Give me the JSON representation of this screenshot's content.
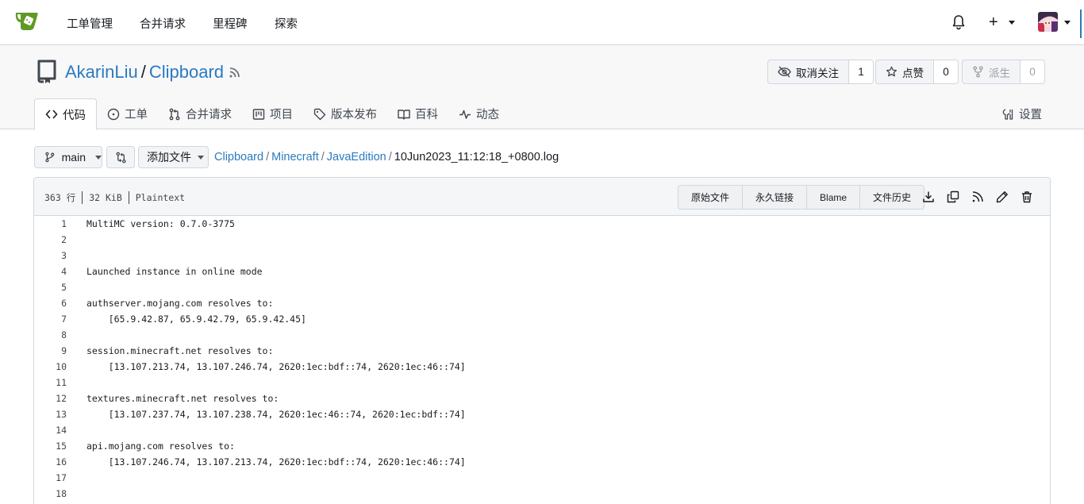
{
  "navbar": {
    "items": [
      {
        "label": "工单管理"
      },
      {
        "label": "合并请求"
      },
      {
        "label": "里程碑"
      },
      {
        "label": "探索"
      }
    ],
    "icons": {
      "bell": "bell-icon",
      "plus": "plus-icon",
      "avatar": "avatar"
    }
  },
  "repo": {
    "owner": "AkarinLiu",
    "separator": "/",
    "name": "Clipboard",
    "watch": {
      "label": "取消关注",
      "count": "1"
    },
    "star": {
      "label": "点赞",
      "count": "0"
    },
    "fork": {
      "label": "派生",
      "count": "0"
    }
  },
  "tabs": [
    {
      "label": "代码",
      "icon": "code-icon"
    },
    {
      "label": "工单",
      "icon": "issue-icon"
    },
    {
      "label": "合并请求",
      "icon": "pull-request-icon"
    },
    {
      "label": "项目",
      "icon": "project-icon"
    },
    {
      "label": "版本发布",
      "icon": "tag-icon"
    },
    {
      "label": "百科",
      "icon": "book-icon"
    },
    {
      "label": "动态",
      "icon": "pulse-icon"
    }
  ],
  "settings_tab": {
    "label": "设置"
  },
  "toolbar": {
    "branch": "main",
    "add_file": "添加文件",
    "breadcrumb": [
      {
        "label": "Clipboard"
      },
      {
        "label": "Minecraft"
      },
      {
        "label": "JavaEdition"
      }
    ],
    "file_name": "10Jun2023_11:12:18_+0800.log",
    "sep": "/"
  },
  "file": {
    "lines_info": "363 行",
    "size": "32 KiB",
    "type": "Plaintext",
    "actions": [
      {
        "label": "原始文件"
      },
      {
        "label": "永久链接"
      },
      {
        "label": "Blame"
      },
      {
        "label": "文件历史"
      }
    ]
  },
  "code_lines": [
    {
      "n": "1",
      "text": "MultiMC version: 0.7.0-3775"
    },
    {
      "n": "2",
      "text": ""
    },
    {
      "n": "3",
      "text": ""
    },
    {
      "n": "4",
      "text": "Launched instance in online mode"
    },
    {
      "n": "5",
      "text": ""
    },
    {
      "n": "6",
      "text": "authserver.mojang.com resolves to:"
    },
    {
      "n": "7",
      "text": "    [65.9.42.87, 65.9.42.79, 65.9.42.45]"
    },
    {
      "n": "8",
      "text": ""
    },
    {
      "n": "9",
      "text": "session.minecraft.net resolves to:"
    },
    {
      "n": "10",
      "text": "    [13.107.213.74, 13.107.246.74, 2620:1ec:bdf::74, 2620:1ec:46::74]"
    },
    {
      "n": "11",
      "text": ""
    },
    {
      "n": "12",
      "text": "textures.minecraft.net resolves to:"
    },
    {
      "n": "13",
      "text": "    [13.107.237.74, 13.107.238.74, 2620:1ec:46::74, 2620:1ec:bdf::74]"
    },
    {
      "n": "14",
      "text": ""
    },
    {
      "n": "15",
      "text": "api.mojang.com resolves to:"
    },
    {
      "n": "16",
      "text": "    [13.107.246.74, 13.107.213.74, 2620:1ec:bdf::74, 2620:1ec:46::74]"
    },
    {
      "n": "17",
      "text": ""
    },
    {
      "n": "18",
      "text": ""
    }
  ],
  "colors": {
    "accent": "#2a7ac0",
    "logo": "#609926"
  }
}
